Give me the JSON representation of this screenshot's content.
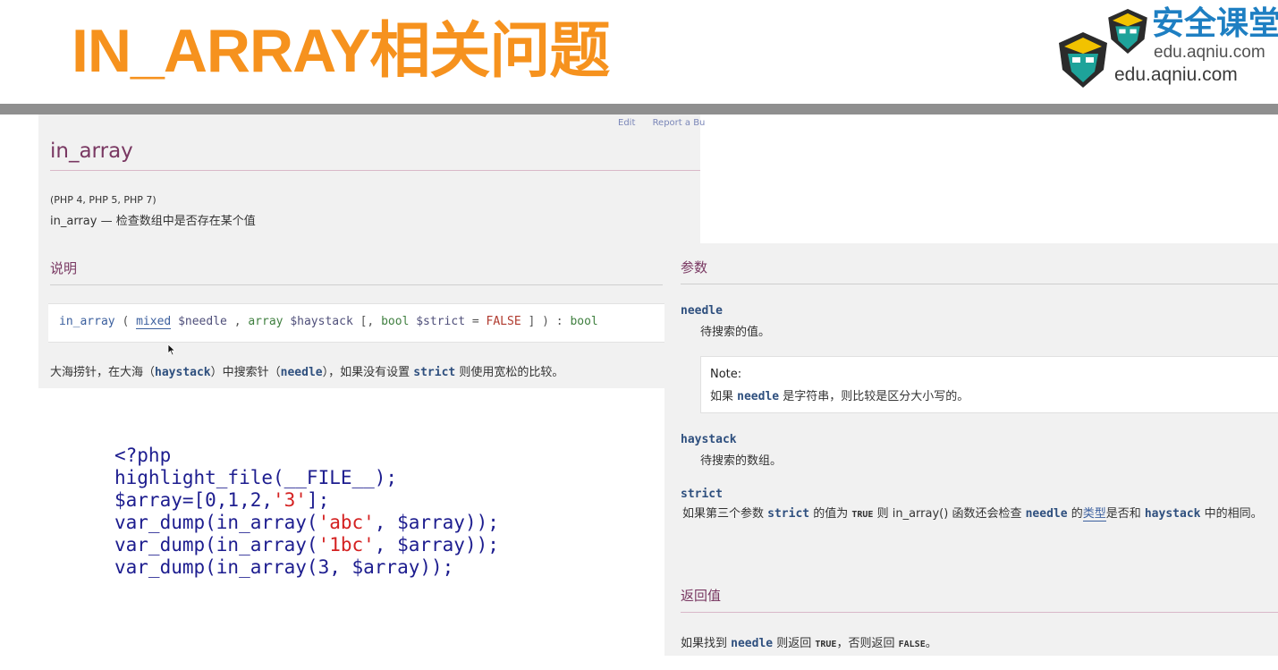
{
  "slide": {
    "title": "IN_ARRAY相关问题"
  },
  "logo": {
    "cn": "安全课堂",
    "url_top": "edu.aqniu.com",
    "url": "edu.aqniu.com"
  },
  "doc": {
    "edit_link": "Edit",
    "report_link": "Report a Bu",
    "function_name": "in_array",
    "versions": "(PHP 4, PHP 5, PHP 7)",
    "purpose": "in_array — 检查数组中是否存在某个值",
    "section_description": "说明",
    "signature": {
      "fn": "in_array",
      "open": " ( ",
      "type1": "mixed",
      "var1": " $needle",
      "sep1": " , ",
      "type2": "array",
      "var2": " $haystack",
      "opt_open": " [, ",
      "type3": "bool",
      "var3": " $strict",
      "eq": " = ",
      "default": "FALSE",
      "close": " ] ) : ",
      "return_type": "bool"
    },
    "desc": {
      "p1": "大海捞针，在大海（",
      "k1": "haystack",
      "p2": "）中搜索针（",
      "k2": "needle",
      "p3": "），如果没有设置 ",
      "k3": "strict",
      "p4": " 则使用宽松的比较。"
    },
    "section_params": "参数",
    "needle": {
      "name": "needle",
      "desc": "待搜索的值。"
    },
    "note": {
      "title": "Note:",
      "p1": "如果 ",
      "k1": "needle",
      "p2": " 是字符串，则比较是区分大小写的。"
    },
    "haystack": {
      "name": "haystack",
      "desc": "待搜索的数组。"
    },
    "strict": {
      "name": "strict",
      "p1": "如果第三个参数 ",
      "k1": "strict",
      "p2": " 的值为 ",
      "c1": "TRUE",
      "p3": " 则 in_array() 函数还会检查 ",
      "k2": "needle",
      "p4": " 的",
      "link": "类型",
      "p5": "是否和 ",
      "k3": "haystack",
      "p6": " 中的相同。"
    },
    "section_return": "返回值",
    "return": {
      "p1": "如果找到 ",
      "k1": "needle",
      "p2": " 则返回 ",
      "c1": "TRUE",
      "p3": "，否则返回 ",
      "c2": "FALSE",
      "p4": "。"
    }
  },
  "code": {
    "line1": "<?php",
    "line2": "highlight_file(__FILE__);",
    "line3_a": "$array=[0,1,2,",
    "line3_s": "'3'",
    "line3_b": "];",
    "line4_a": "var_dump(in_array(",
    "line4_s": "'abc'",
    "line4_b": ", $array));",
    "line5_a": "var_dump(in_array(",
    "line5_s": "'1bc'",
    "line5_b": ", $array));",
    "line6": "var_dump(in_array(3, $array));"
  },
  "colors": {
    "title_orange": "#f6921e",
    "doc_heading": "#793862",
    "keyword_blue": "#2e4f7e",
    "code_blue": "#1d1d8f",
    "code_string_red": "#d42121"
  }
}
